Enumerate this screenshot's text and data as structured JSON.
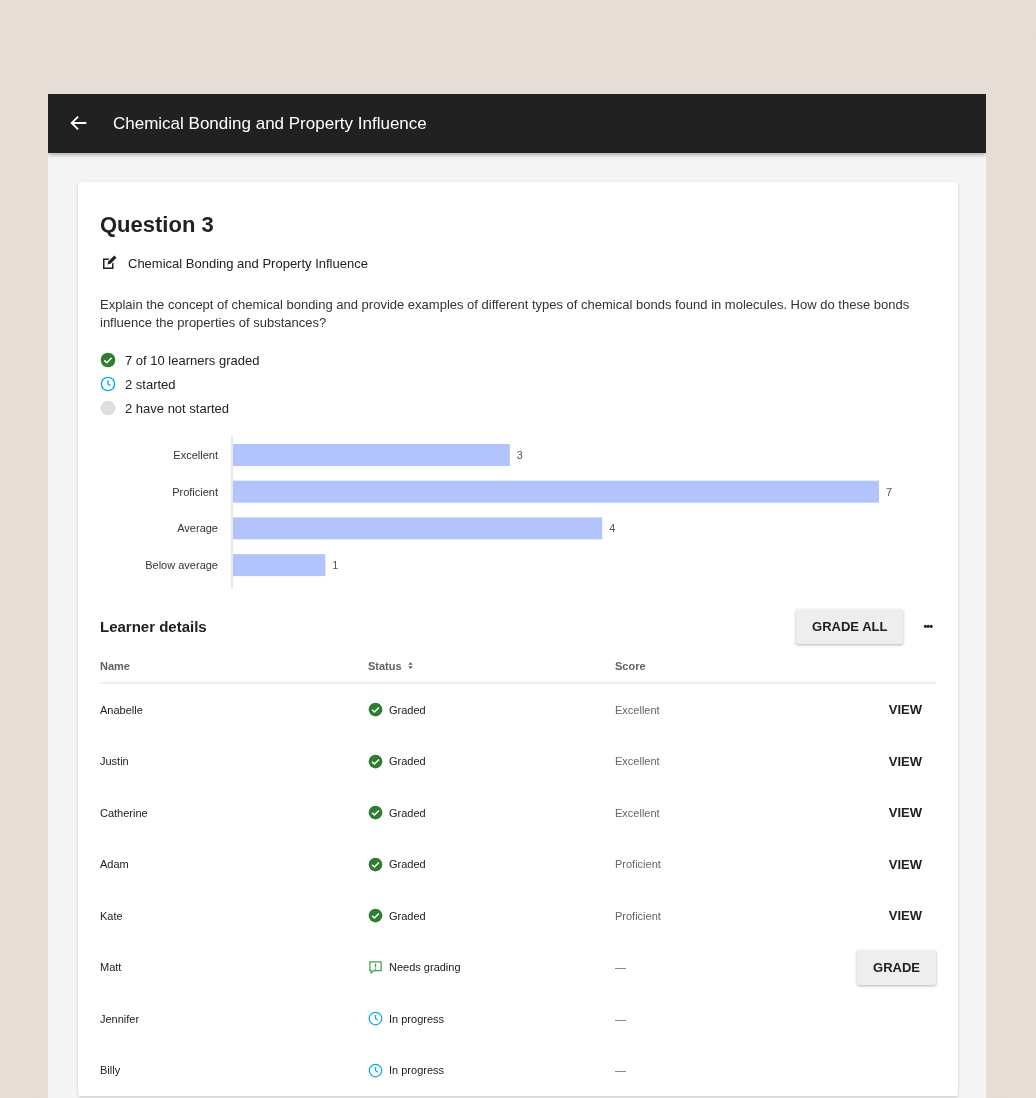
{
  "app_bar": {
    "title": "Chemical Bonding and Property Influence"
  },
  "question": {
    "heading": "Question 3",
    "topic": "Chemical Bonding and Property Influence",
    "prompt": "Explain the concept of chemical bonding and provide examples of different types of chemical bonds found in molecules. How do these bonds influence the properties of substances?"
  },
  "progress": [
    {
      "kind": "graded",
      "text": "7 of 10 learners graded"
    },
    {
      "kind": "started",
      "text": "2 started"
    },
    {
      "kind": "not_started",
      "text": "2 have not started"
    }
  ],
  "chart_data": {
    "type": "bar",
    "orientation": "horizontal",
    "categories": [
      "Excellent",
      "Proficient",
      "Average",
      "Below average"
    ],
    "values": [
      3,
      7,
      4,
      1
    ],
    "data_labels": true
  },
  "learner_details": {
    "title": "Learner details",
    "grade_all_button": "GRADE ALL",
    "more_button": "•••",
    "columns": [
      {
        "label": "Name",
        "sortable": false
      },
      {
        "label": "Status",
        "sortable": true
      },
      {
        "label": "Score",
        "sortable": false
      }
    ],
    "rows": [
      {
        "name": "Anabelle",
        "status": {
          "kind": "graded",
          "text": "Graded"
        },
        "score": "Excellent",
        "action": {
          "kind": "link",
          "label": "VIEW"
        }
      },
      {
        "name": "Justin",
        "status": {
          "kind": "graded",
          "text": "Graded"
        },
        "score": "Excellent",
        "action": {
          "kind": "link",
          "label": "VIEW"
        }
      },
      {
        "name": "Catherine",
        "status": {
          "kind": "graded",
          "text": "Graded"
        },
        "score": "Excellent",
        "action": {
          "kind": "link",
          "label": "VIEW"
        }
      },
      {
        "name": "Adam",
        "status": {
          "kind": "graded",
          "text": "Graded"
        },
        "score": "Proficient",
        "action": {
          "kind": "link",
          "label": "VIEW"
        }
      },
      {
        "name": "Kate",
        "status": {
          "kind": "graded",
          "text": "Graded"
        },
        "score": "Proficient",
        "action": {
          "kind": "link",
          "label": "VIEW"
        }
      },
      {
        "name": "Matt",
        "status": {
          "kind": "needs_grading",
          "text": "Needs grading"
        },
        "score": "—",
        "action": {
          "kind": "button",
          "label": "GRADE"
        }
      },
      {
        "name": "Jennifer",
        "status": {
          "kind": "in_progress",
          "text": "In progress"
        },
        "score": "—"
      },
      {
        "name": "Billy",
        "status": {
          "kind": "in_progress",
          "text": "In progress"
        },
        "score": "—"
      }
    ]
  }
}
